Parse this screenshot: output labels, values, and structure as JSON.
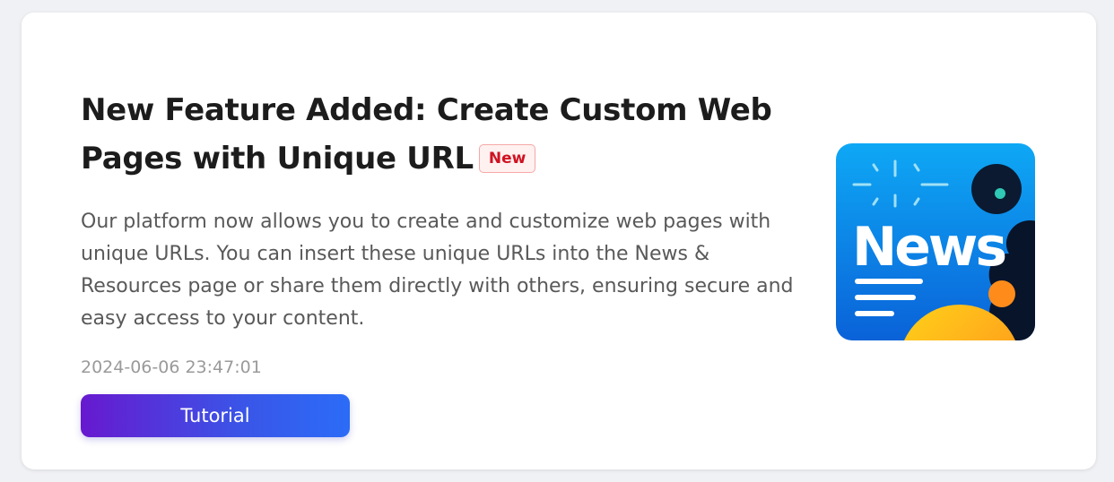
{
  "announcement": {
    "title": "New Feature Added: Create Custom Web Pages with Unique URL",
    "badge": "New",
    "description": "Our platform now allows you to create and customize web pages with unique URLs. You can insert these unique URLs into the News & Resources page or share them directly with others, ensuring secure and easy access to your content.",
    "timestamp": "2024-06-06 23:47:01",
    "button_label": "Tutorial",
    "image_text": "News",
    "image_icon": "news-illustration-icon"
  },
  "colors": {
    "badge_text": "#cf1322",
    "button_gradient_start": "#6719cf",
    "button_gradient_end": "#2b6cf7",
    "image_background": "#0a7de8"
  }
}
